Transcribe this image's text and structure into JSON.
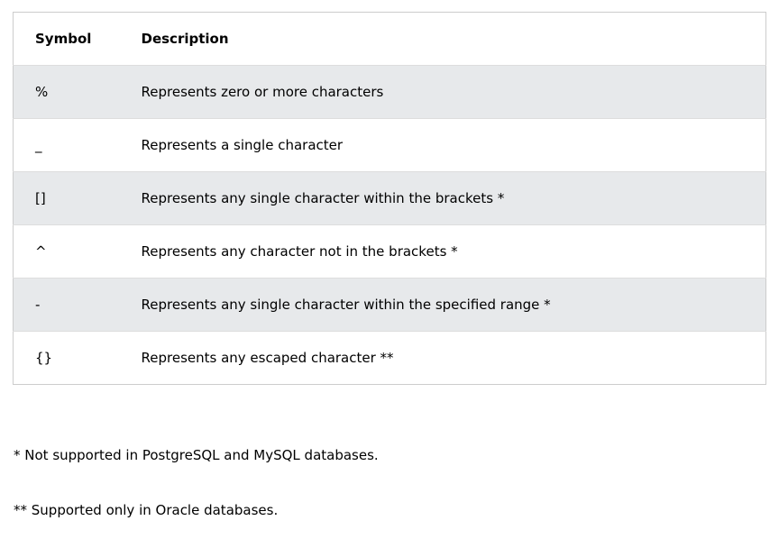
{
  "table": {
    "headers": [
      "Symbol",
      "Description"
    ],
    "rows": [
      {
        "symbol": "%",
        "description": "Represents zero or more characters"
      },
      {
        "symbol": "_",
        "description": "Represents a single character"
      },
      {
        "symbol": "[]",
        "description": "Represents any single character within the brackets *"
      },
      {
        "symbol": "^",
        "description": "Represents any character not in the brackets *"
      },
      {
        "symbol": "-",
        "description": "Represents any single character within the specified range *"
      },
      {
        "symbol": "{}",
        "description": "Represents any escaped character **"
      }
    ]
  },
  "notes": {
    "note1": "* Not supported in PostgreSQL and MySQL databases.",
    "note2": "** Supported only in Oracle databases."
  },
  "colors": {
    "row_shade": "#e7e9eb",
    "border": "#cccccc"
  }
}
